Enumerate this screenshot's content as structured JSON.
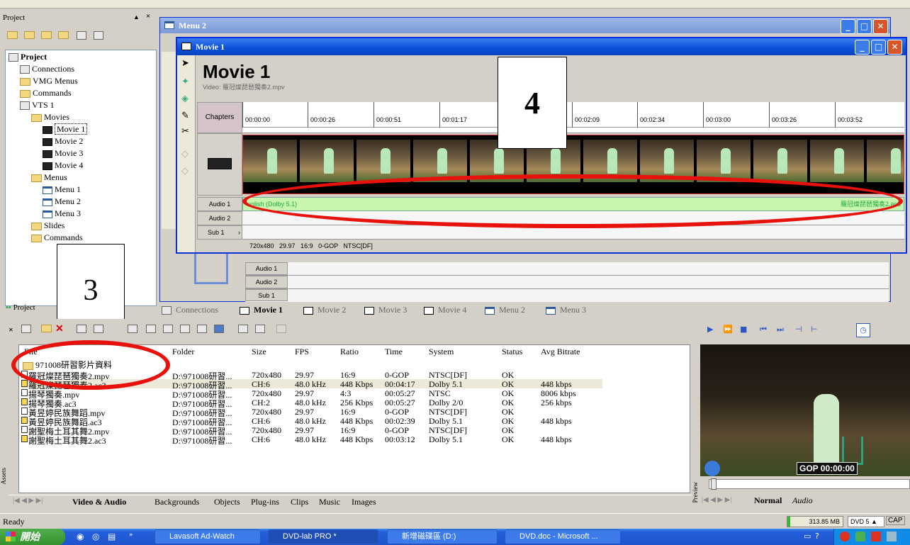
{
  "project_panel": {
    "title": "Project",
    "tree": [
      {
        "label": "Project",
        "indent": 0,
        "icon": "project-icon",
        "bold": true
      },
      {
        "label": "Connections",
        "indent": 1,
        "icon": "connections-icon"
      },
      {
        "label": "VMG Menus",
        "indent": 1,
        "icon": "folder-icon"
      },
      {
        "label": "Commands",
        "indent": 1,
        "icon": "folder-icon"
      },
      {
        "label": "VTS 1",
        "indent": 1,
        "icon": "vts-icon"
      },
      {
        "label": "Movies",
        "indent": 2,
        "icon": "folder-icon"
      },
      {
        "label": "Movie 1",
        "indent": 3,
        "icon": "film-icon",
        "selected": true
      },
      {
        "label": "Movie 2",
        "indent": 3,
        "icon": "film-icon"
      },
      {
        "label": "Movie 3",
        "indent": 3,
        "icon": "film-icon"
      },
      {
        "label": "Movie 4",
        "indent": 3,
        "icon": "film-icon"
      },
      {
        "label": "Menus",
        "indent": 2,
        "icon": "folder-icon"
      },
      {
        "label": "Menu 1",
        "indent": 3,
        "icon": "menu-icon"
      },
      {
        "label": "Menu 2",
        "indent": 3,
        "icon": "menu-icon"
      },
      {
        "label": "Menu 3",
        "indent": 3,
        "icon": "menu-icon"
      },
      {
        "label": "Slides",
        "indent": 2,
        "icon": "folder-icon"
      },
      {
        "label": "Commands",
        "indent": 2,
        "icon": "folder-icon"
      }
    ],
    "footer_tab": "Project"
  },
  "annotations": {
    "box3": "3",
    "box4": "4"
  },
  "menu2_window": {
    "title": "Menu 2"
  },
  "movie1_window": {
    "title": "Movie 1",
    "heading": "Movie 1",
    "video_label": "Video: 羅冠燦琵琶獨奏2.mpv",
    "chapters_label": "Chapters",
    "ticks": [
      "00:00:00",
      "00:00:26",
      "00:00:51",
      "00:01:17",
      "00:02:09",
      "00:02:34",
      "00:03:00",
      "00:03:26",
      "00:03:52"
    ],
    "audio1_label": "Audio 1",
    "audio2_label": "Audio 2",
    "sub1_label": "Sub 1",
    "audio1_track_left": "nglish (Dolby 5.1)",
    "audio1_track_right": "羅冠燦琵琶獨奏2.ac3",
    "info_line": "720x480   29.97   16:9   0-GOP   NTSC[DF]"
  },
  "behind_tracks": {
    "audio1": "Audio 1",
    "audio2": "Audio 2",
    "sub1": "Sub 1"
  },
  "doc_tabs": [
    "Connections",
    "Movie 1",
    "Movie 2",
    "Movie 3",
    "Movie 4",
    "Menu 2",
    "Menu 3"
  ],
  "assets": {
    "columns": [
      "File",
      "Folder",
      "Size",
      "FPS",
      "Ratio",
      "Time",
      "System",
      "Status",
      "Avg Bitrate"
    ],
    "group": "971008研習影片資料",
    "rows": [
      {
        "file": "羅冠燦琵琶獨奏2.mpv",
        "folder": "D:\\971008研習...",
        "size": "720x480",
        "fps": "29.97",
        "ratio": "16:9",
        "time": "0-GOP",
        "system": "NTSC[DF]",
        "status": "OK",
        "bitrate": "",
        "type": "video"
      },
      {
        "file": "羅冠燦琵琶獨奏2.ac3",
        "folder": "D:\\971008研習...",
        "size": "CH:6",
        "fps": "48.0 kHz",
        "ratio": "448 Kbps",
        "time": "00:04:17",
        "system": "Dolby 5.1",
        "status": "OK",
        "bitrate": "448 kbps",
        "type": "audio"
      },
      {
        "file": "揚琴獨奏.mpv",
        "folder": "D:\\971008研習...",
        "size": "720x480",
        "fps": "29.97",
        "ratio": "4:3",
        "time": "00:05:27",
        "system": "NTSC",
        "status": "OK",
        "bitrate": "8006 kbps",
        "type": "video"
      },
      {
        "file": "揚琴獨奏.ac3",
        "folder": "D:\\971008研習...",
        "size": "CH:2",
        "fps": "48.0 kHz",
        "ratio": "256 Kbps",
        "time": "00:05:27",
        "system": "Dolby 2/0",
        "status": "OK",
        "bitrate": "256 kbps",
        "type": "audio"
      },
      {
        "file": "黃昱婷民族舞蹈.mpv",
        "folder": "D:\\971008研習...",
        "size": "720x480",
        "fps": "29.97",
        "ratio": "16:9",
        "time": "0-GOP",
        "system": "NTSC[DF]",
        "status": "OK",
        "bitrate": "",
        "type": "video"
      },
      {
        "file": "黃昱婷民族舞蹈.ac3",
        "folder": "D:\\971008研習...",
        "size": "CH:6",
        "fps": "48.0 kHz",
        "ratio": "448 Kbps",
        "time": "00:02:39",
        "system": "Dolby 5.1",
        "status": "OK",
        "bitrate": "448 kbps",
        "type": "audio"
      },
      {
        "file": "謝聖梅土耳其舞2.mpv",
        "folder": "D:\\971008研習...",
        "size": "720x480",
        "fps": "29.97",
        "ratio": "16:9",
        "time": "0-GOP",
        "system": "NTSC[DF]",
        "status": "OK",
        "bitrate": "",
        "type": "video"
      },
      {
        "file": "謝聖梅土耳其舞2.ac3",
        "folder": "D:\\971008研習...",
        "size": "CH:6",
        "fps": "48.0 kHz",
        "ratio": "448 Kbps",
        "time": "00:03:12",
        "system": "Dolby 5.1",
        "status": "OK",
        "bitrate": "448 kbps",
        "type": "audio"
      }
    ],
    "side_label": "Assets",
    "bottom_tabs": [
      "Video & Audio",
      "Backgrounds",
      "Objects",
      "Plug-ins",
      "Clips",
      "Music",
      "Images"
    ]
  },
  "preview": {
    "side_label": "Preview",
    "timecode": "GOP 00:00:00",
    "tabs": [
      "Normal",
      "Audio"
    ]
  },
  "status_bar": {
    "text": "Ready",
    "memory": "313.85 MB",
    "dvd": "DVD 5",
    "cap": "CAP"
  },
  "taskbar": {
    "start": "開始",
    "items": [
      "Lavasoft Ad-Watch",
      "DVD-lab PRO *",
      "新增磁碟區 (D:)",
      "DVD.doc - Microsoft ..."
    ]
  },
  "colors": {
    "accent": "#0a246a",
    "xp_blue": "#245edb",
    "timeline_green": "#c8f5b0",
    "highlight_red": "#e8120c"
  }
}
